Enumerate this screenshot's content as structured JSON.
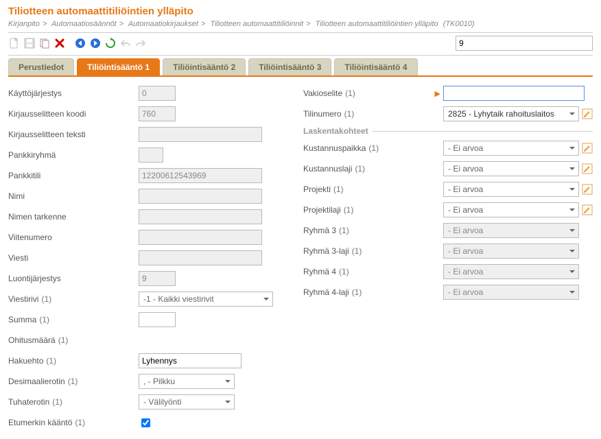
{
  "title": "Tiliotteen automaattitiliöintien ylläpito",
  "breadcrumb": {
    "parts": [
      "Kirjanpito",
      "Automaatiosäännöt",
      "Automaatiokirjaukset",
      "Tiliotteen automaattitiliöinnit",
      "Tiliotteen automaattitiliöintien ylläpito"
    ],
    "code": "(TK0010)"
  },
  "toolbar": {
    "search_value": "9"
  },
  "tabs": [
    {
      "id": "perustiedot",
      "label": "Perustiedot",
      "active": false
    },
    {
      "id": "r1",
      "label": "Tiliöintisääntö 1",
      "active": true
    },
    {
      "id": "r2",
      "label": "Tiliöintisääntö 2",
      "active": false
    },
    {
      "id": "r3",
      "label": "Tiliöintisääntö 3",
      "active": false
    },
    {
      "id": "r4",
      "label": "Tiliöintisääntö 4",
      "active": false
    }
  ],
  "left": {
    "kayttojarjestys": {
      "label": "Käyttöjärjestys",
      "value": "0"
    },
    "kirjausselitteen_koodi": {
      "label": "Kirjausselitteen koodi",
      "value": "760"
    },
    "kirjausselitteen_teksti": {
      "label": "Kirjausselitteen teksti",
      "value": ""
    },
    "pankkiryhma": {
      "label": "Pankkiryhmä",
      "value": ""
    },
    "pankkitili": {
      "label": "Pankkitili",
      "value": "12200612543969"
    },
    "nimi": {
      "label": "Nimi",
      "value": ""
    },
    "nimen_tarkenne": {
      "label": "Nimen tarkenne",
      "value": ""
    },
    "viitenumero": {
      "label": "Viitenumero",
      "value": ""
    },
    "viesti": {
      "label": "Viesti",
      "value": ""
    },
    "luontijarjestys": {
      "label": "Luontijärjestys",
      "value": "9"
    },
    "viestirivi": {
      "label": "Viestirivi",
      "suffix": "(1)",
      "value": "-1 - Kaikki viestirivit"
    },
    "summa": {
      "label": "Summa",
      "suffix": "(1)",
      "value": ""
    },
    "ohitusmaara": {
      "label": "Ohitusmäärä",
      "suffix": "(1)",
      "value": ""
    },
    "hakuehto": {
      "label": "Hakuehto",
      "suffix": "(1)",
      "value": "Lyhennys"
    },
    "desimaalierotin": {
      "label": "Desimaalierotin",
      "suffix": "(1)",
      "value": ", - Pilkku"
    },
    "tuhaterotin": {
      "label": "Tuhaterotin",
      "suffix": "(1)",
      "value": "  - Välilyönti"
    },
    "etumerkin_kaanto": {
      "label": "Etumerkin kääntö",
      "suffix": "(1)",
      "checked": true
    }
  },
  "right": {
    "vakioselite": {
      "label": "Vakioselite",
      "suffix": "(1)",
      "value": "",
      "highlight": true
    },
    "tilinumero": {
      "label": "Tilinumero",
      "suffix": "(1)",
      "value": "2825 - Lyhytaik rahoituslaitos"
    },
    "legend": "Laskentakohteet",
    "fields": [
      {
        "key": "kustannuspaikka",
        "label": "Kustannuspaikka",
        "suffix": "(1)",
        "value": " -  Ei arvoa",
        "editable": true
      },
      {
        "key": "kustannuslaji",
        "label": "Kustannuslaji",
        "suffix": "(1)",
        "value": " -  Ei arvoa",
        "editable": true
      },
      {
        "key": "projekti",
        "label": "Projekti",
        "suffix": "(1)",
        "value": " -  Ei arvoa",
        "editable": true
      },
      {
        "key": "projektilaji",
        "label": "Projektilaji",
        "suffix": "(1)",
        "value": " -  Ei arvoa",
        "editable": true
      },
      {
        "key": "ryhma3",
        "label": "Ryhmä 3",
        "suffix": "(1)",
        "value": " -  Ei arvoa",
        "editable": false
      },
      {
        "key": "ryhma3laji",
        "label": "Ryhmä 3-laji",
        "suffix": "(1)",
        "value": " -  Ei arvoa",
        "editable": false
      },
      {
        "key": "ryhma4",
        "label": "Ryhmä 4",
        "suffix": "(1)",
        "value": " -  Ei arvoa",
        "editable": false
      },
      {
        "key": "ryhma4laji",
        "label": "Ryhmä 4-laji",
        "suffix": "(1)",
        "value": " -  Ei arvoa",
        "editable": false
      }
    ]
  }
}
